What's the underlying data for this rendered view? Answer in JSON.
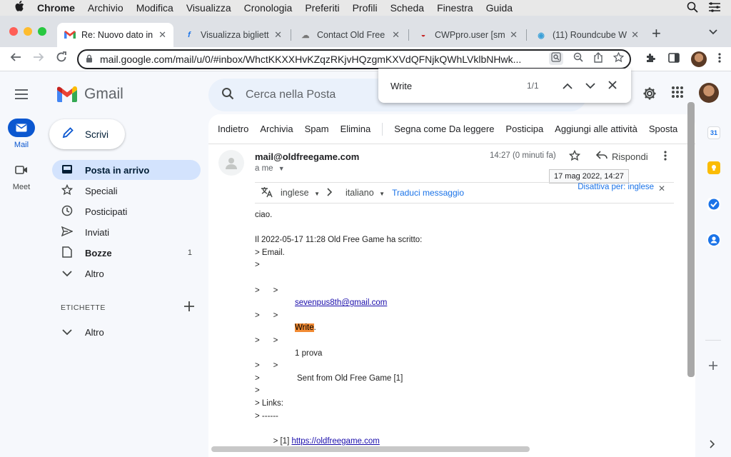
{
  "menubar": {
    "apple": "",
    "items": [
      "Chrome",
      "Archivio",
      "Modifica",
      "Visualizza",
      "Cronologia",
      "Preferiti",
      "Profili",
      "Scheda",
      "Finestra",
      "Guida"
    ]
  },
  "tabs": [
    {
      "label": "Re: Nuovo dato in",
      "favicon": "M",
      "active": true
    },
    {
      "label": "Visualizza bigliett",
      "favicon": "f"
    },
    {
      "label": "Contact Old Free",
      "favicon": "☁"
    },
    {
      "label": "CWPpro.user [sm",
      "favicon": "◒"
    },
    {
      "label": "(11) Roundcube W",
      "favicon": "◉"
    }
  ],
  "toolbar": {
    "url": "mail.google.com/mail/u/0/#inbox/WhctKKXXHvKZqzRKjvHQzgmKXVdQFNjkQWhLVklbNHwk..."
  },
  "findbar": {
    "query": "Write",
    "count": "1/1"
  },
  "gmail": {
    "logo_text": "Gmail",
    "search_placeholder": "Cerca nella Posta",
    "compose_label": "Scrivi",
    "rail": [
      {
        "label": "Mail"
      },
      {
        "label": "Meet"
      }
    ],
    "nav": [
      {
        "label": "Posta in arrivo",
        "count": ""
      },
      {
        "label": "Speciali",
        "count": ""
      },
      {
        "label": "Posticipati",
        "count": ""
      },
      {
        "label": "Inviati",
        "count": ""
      },
      {
        "label": "Bozze",
        "count": "1"
      },
      {
        "label": "Altro",
        "count": ""
      }
    ],
    "labels_heading": "ETICHETTE",
    "labels_more": "Altro"
  },
  "actions": [
    "Indietro",
    "Archivia",
    "Spam",
    "Elimina",
    "Segna come Da leggere",
    "Posticipa",
    "Aggiungi alle attività",
    "Sposta"
  ],
  "message": {
    "sender": "mail@oldfreegame.com",
    "to": "a me",
    "time": "14:27 (0 minuti fa)",
    "reply_label": "Rispondi",
    "tooltip": "17 mag 2022, 14:27",
    "translate": {
      "from": "inglese",
      "to": "italiano",
      "translate_link": "Traduci messaggio",
      "disable": "Disattiva per: inglese"
    },
    "body": {
      "greeting": "ciao.",
      "quote_header": "Il 2022-05-17 11:28 Old Free Game ha scritto:",
      "email_label": "> Email.",
      "gt": ">",
      "email_link": "sevenpus8th@gmail.com",
      "write_word": "Write",
      "write_dot": ".",
      "prova": "1 prova",
      "sent_from": "Sent from Old Free Game [1]",
      "links_label": "> Links:",
      "dashes": "> ------",
      "link_prefix": "> [1] ",
      "link_url": "https://oldfreegame.com"
    }
  },
  "colors": {
    "active_nav": "#d3e3fd",
    "find_highlight": "#f28b34",
    "link": "#1a0dab"
  }
}
